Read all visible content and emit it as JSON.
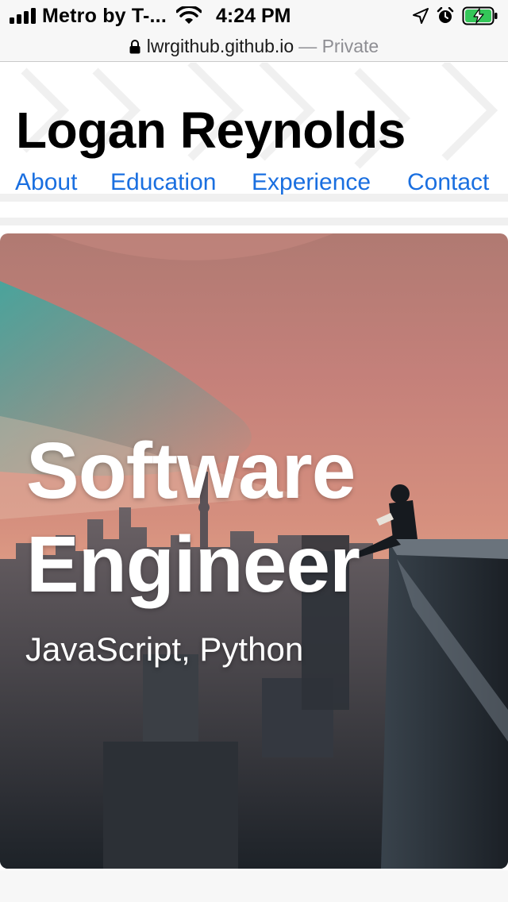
{
  "status_bar": {
    "carrier": "Metro by T-...",
    "time": "4:24 PM",
    "icons": [
      "signal-icon",
      "wifi-icon",
      "location-arrow-icon",
      "alarm-icon",
      "battery-charging-icon"
    ]
  },
  "address_bar": {
    "domain": "lwrgithub.github.io",
    "privacy": "— Private",
    "icon": "lock-icon"
  },
  "header": {
    "title": "Logan Reynolds"
  },
  "nav": {
    "items": [
      {
        "label": "About"
      },
      {
        "label": "Education"
      },
      {
        "label": "Experience"
      },
      {
        "label": "Contact"
      }
    ],
    "link_color": "#1a6fe0"
  },
  "hero": {
    "title_line1": "Software",
    "title_line2": "Engineer",
    "subtitle": "JavaScript, Python"
  }
}
